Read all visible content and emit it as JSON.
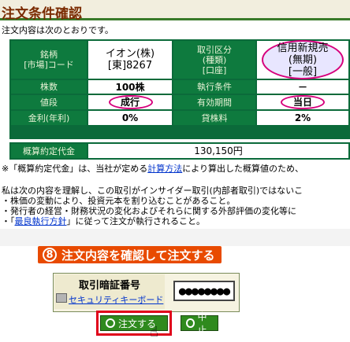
{
  "header": {
    "title": "注文条件確認",
    "subtitle": "注文内容は次のとおりです。"
  },
  "order_table": {
    "row1": {
      "label_a": "銘柄\n[市場]コード",
      "value_a": "イオン(株)\n[東]8267",
      "label_b": "取引区分\n(種類)\n[口座]",
      "value_b": "信用新規売\n(無期)\n[一般]"
    },
    "row2": {
      "label_a": "株数",
      "value_a": "100株",
      "label_b": "執行条件",
      "value_b": "－"
    },
    "row3": {
      "label_a": "値段",
      "value_a": "成行",
      "label_b": "有効期間",
      "value_b": "当日"
    },
    "row4": {
      "label_a": "金利(年利)",
      "value_a": "0%",
      "label_b": "貸株料",
      "value_b": "2%"
    },
    "total": {
      "label": "概算約定代金",
      "value": "130,150円"
    }
  },
  "note": {
    "prefix": "※「概算約定代金」は、当社が定める",
    "link": "計算方法",
    "suffix": "により算出した概算値のため、"
  },
  "consent": {
    "line1": "私は次の内容を理解し、この取引がインサイダー取引(内部者取引)ではないこ",
    "line2": "・株価の変動により、投資元本を割り込むことがあること。",
    "line3": "・発行者の経営・財務状況の変化およびそれらに関する外部評価の変化等に",
    "line4_prefix": "・「",
    "line4_link": "最良執行方針",
    "line4_suffix": "」に従って注文が執行されること。"
  },
  "step_banner": {
    "number": "8",
    "text": "注文内容を確認して注文する"
  },
  "pin": {
    "label": "取引暗証番号",
    "keyboard_link": "セキュリティキーボード",
    "value": "●●●●●●●●"
  },
  "buttons": {
    "order": "注文する",
    "cancel": "中止"
  },
  "colors": {
    "table_header_green": "#0e7a3e",
    "highlight_oval": "#d6007c",
    "banner_orange": "#e84a00",
    "button_green": "#2f8a1e"
  }
}
